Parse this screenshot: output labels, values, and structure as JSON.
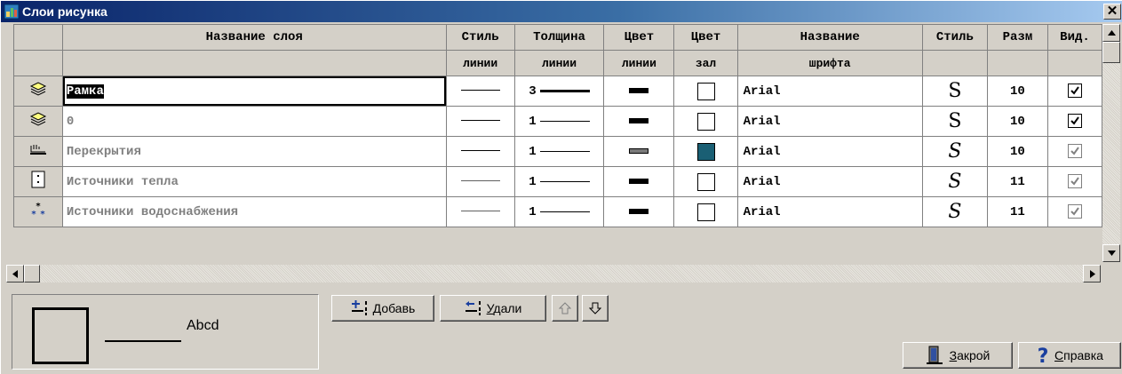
{
  "window": {
    "title": "Слои рисунка",
    "close_glyph": "✕"
  },
  "grid": {
    "headers_row1": [
      "",
      "Название слоя",
      "Стиль",
      "Толщина",
      "Цвет",
      "Цвет",
      "Название",
      "Стиль",
      "Разм",
      "Вид."
    ],
    "headers_row2": [
      "",
      "",
      "линии",
      "линии",
      "линии",
      "зал",
      "шрифта",
      "",
      "",
      ""
    ],
    "rows": [
      {
        "icon": "layers-stack-icon",
        "name": "Рамка",
        "dim": false,
        "line_style": "solid",
        "thickness": "3",
        "line_color": "#000000",
        "fill_color": "#ffffff",
        "font": "Arial",
        "font_style": "S",
        "italic": false,
        "size": "10",
        "visible": true
      },
      {
        "icon": "layers-stack-icon",
        "name": "0",
        "dim": true,
        "line_style": "solid",
        "thickness": "1",
        "line_color": "#000000",
        "fill_color": "#ffffff",
        "font": "Arial",
        "font_style": "S",
        "italic": false,
        "size": "10",
        "visible": true
      },
      {
        "icon": "overlap-layer-icon",
        "name": "Перекрытия",
        "dim": true,
        "line_style": "solid",
        "thickness": "1",
        "line_color": "#7a7a7a",
        "fill_color": "#1a5f74",
        "font": "Arial",
        "font_style": "S",
        "italic": true,
        "size": "10",
        "visible": true
      },
      {
        "icon": "heat-source-icon",
        "name": "Источники тепла",
        "dim": true,
        "line_style": "solid",
        "thickness": "1",
        "line_color": "#000000",
        "fill_color": "#ffffff",
        "font": "Arial",
        "font_style": "S",
        "italic": true,
        "size": "11",
        "visible": true
      },
      {
        "icon": "water-source-icon",
        "name": "Источники водоснабжения",
        "dim": true,
        "line_style": "solid",
        "thickness": "1",
        "line_color": "#000000",
        "fill_color": "#ffffff",
        "font": "Arial",
        "font_style": "S",
        "italic": true,
        "size": "11",
        "visible": true
      }
    ]
  },
  "preview": {
    "sample_text": "Abcd"
  },
  "buttons": {
    "add": {
      "hotkey": "Д",
      "rest": "обавь"
    },
    "delete": {
      "hotkey": "У",
      "rest": "дали"
    },
    "close": {
      "hotkey": "З",
      "rest": "акрой"
    },
    "help": {
      "hotkey": "С",
      "rest": "правка"
    }
  },
  "colors": {
    "title_start": "#0a246a",
    "title_end": "#a6caf0",
    "face": "#d4d0c8",
    "teal_fill": "#1a5f74"
  }
}
